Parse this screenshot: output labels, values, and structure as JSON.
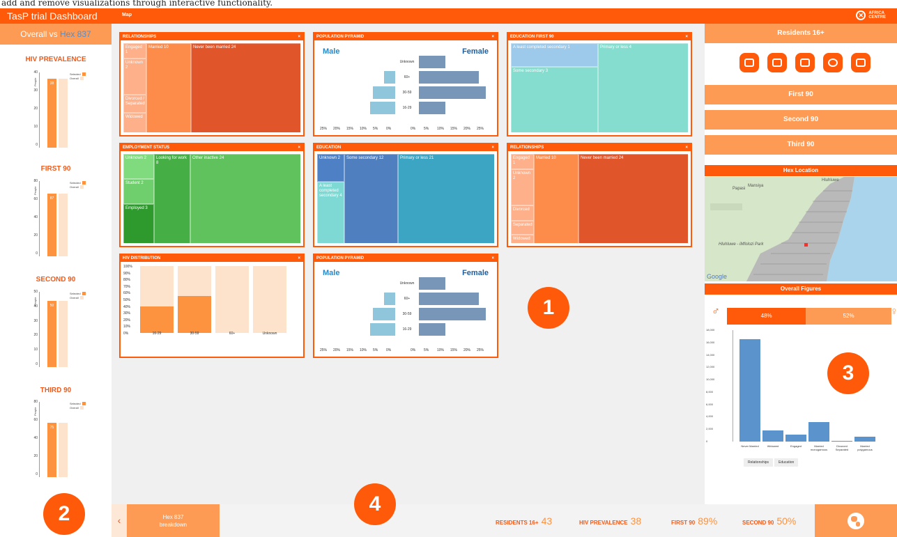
{
  "caption": "add and remove visualizations through interactive functionality.",
  "app": {
    "title": "TasP trial Dashboard",
    "map_tab": "Map",
    "logo_line1": "AFRICA",
    "logo_line2": "CENTRE"
  },
  "left": {
    "header_prefix": "Overall vs",
    "header_hex": "Hex 837",
    "charts": [
      {
        "title": "HIV PREVALENCE",
        "selected": 38,
        "ticks": [
          "40",
          "30",
          "20",
          "10",
          "0"
        ],
        "ymax": 40
      },
      {
        "title": "FIRST 90",
        "selected": 87,
        "ticks": [
          "80",
          "60",
          "40",
          "20",
          "0"
        ],
        "ymax": 100
      },
      {
        "title": "SECOND 90",
        "selected": 50,
        "ticks": [
          "50",
          "40",
          "30",
          "20",
          "10",
          "0"
        ],
        "ymax": 55
      },
      {
        "title": "THIRD 90",
        "selected": 75,
        "ticks": [
          "80",
          "60",
          "40",
          "20",
          "0"
        ],
        "ymax": 100
      }
    ],
    "legend_selected": "Selected",
    "legend_overall": "Overall",
    "ylabel": "People",
    "badge": "2"
  },
  "panels": {
    "p1": {
      "title": "RELATIONSHIPS",
      "cells": [
        "Engaged 1",
        "Unknown 2",
        "Divorced / Separated",
        "Widowed",
        "Married 10",
        "Never been married 24"
      ]
    },
    "p2": {
      "title": "POPULATION PYRAMID",
      "male": "Male",
      "female": "Female",
      "ages": [
        "Unknown",
        "60+",
        "30-59",
        "16-29"
      ],
      "axis_left": [
        "25%",
        "20%",
        "15%",
        "10%",
        "5%",
        "0%"
      ],
      "axis_right": [
        "0%",
        "5%",
        "10%",
        "15%",
        "20%",
        "25%"
      ]
    },
    "p3": {
      "title": "EDUCATION FIRST 90",
      "cells": [
        "A least completed secondary 1",
        "Some secondary 3",
        "Primary or less 4"
      ]
    },
    "p4": {
      "title": "EMPLOYMENT STATUS",
      "cells": [
        "Unknown 2",
        "Student 2",
        "Employed 3",
        "Looking for work 8",
        "Other inactive 24"
      ]
    },
    "p5": {
      "title": "EDUCATION",
      "cells": [
        "Unknown 2",
        "A least completed secondary 4",
        "Some secondary 12",
        "Primary or less 21"
      ]
    },
    "p6": {
      "title": "RELATIONSHIPS",
      "cells": [
        "Engaged 1",
        "Unknown 2",
        "Divorced",
        "Separated",
        "Widowed",
        "Married 10",
        "Never been married 24"
      ]
    },
    "p7": {
      "title": "HIV DISTRIBUTION",
      "ticks": [
        "100%",
        "90%",
        "80%",
        "70%",
        "60%",
        "50%",
        "40%",
        "30%",
        "20%",
        "10%",
        "0%"
      ],
      "cats": [
        "16-29",
        "30-59",
        "60+",
        "Unknown"
      ]
    },
    "p8": {
      "title": "POPULATION PYRAMID",
      "male": "Male",
      "female": "Female",
      "ages": [
        "Unknown",
        "60+",
        "30-59",
        "16-29"
      ],
      "axis_left": [
        "25%",
        "20%",
        "15%",
        "10%",
        "5%",
        "0%"
      ],
      "axis_right": [
        "0%",
        "5%",
        "10%",
        "15%",
        "20%",
        "25%"
      ]
    },
    "close": "×",
    "badge": "1"
  },
  "right": {
    "residents": "Residents 16+",
    "first": "First 90",
    "second": "Second 90",
    "third": "Third 90",
    "hex_location": "Hex Location",
    "map_labels": [
      "Hluhluwe",
      "Mansiya",
      "Papasi",
      "Hluhluwe - iMfolozi Park",
      "Google"
    ],
    "overall_figures": "Overall Figures",
    "male_pct": "48%",
    "female_pct": "52%",
    "yticks": [
      "18,000",
      "16,000",
      "14,000",
      "12,000",
      "10,000",
      "8,000",
      "6,000",
      "4,000",
      "2,000",
      "0"
    ],
    "bar_labels": [
      "Never Married",
      "Widowed",
      "Engaged",
      "Married monogamous",
      "Divorced Separated",
      "Married polygamous"
    ],
    "bar_values": [
      16500,
      1800,
      1100,
      3100,
      100,
      800
    ],
    "tabs": [
      "Relationships",
      "Education"
    ],
    "badge": "3"
  },
  "bottom": {
    "back": "‹",
    "hex_line1": "Hex 837",
    "hex_line2": "breakdown",
    "badge": "4",
    "stats": [
      {
        "label": "RESIDENTS 16+",
        "value": "43"
      },
      {
        "label": "HIV PREVALENCE",
        "value": "38"
      },
      {
        "label": "FIRST 90",
        "value": "89%"
      },
      {
        "label": "SECOND 90",
        "value": "50%"
      }
    ]
  }
}
